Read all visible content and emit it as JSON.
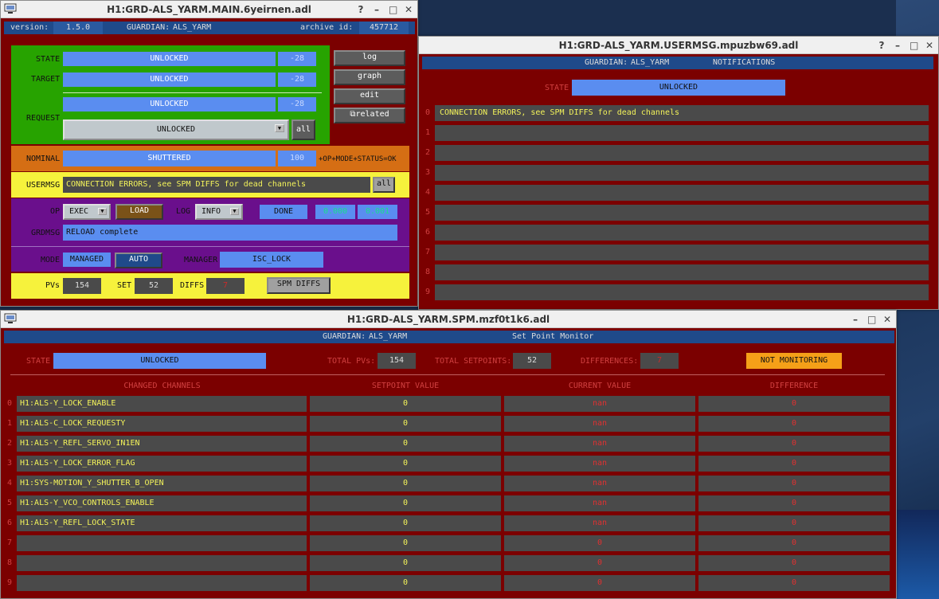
{
  "desktop": {
    "accent": "#1f4a8a"
  },
  "main": {
    "title": "H1:GRD-ALS_YARM.MAIN.6yeirnen.adl",
    "version_label": "version:",
    "version": "1.5.0",
    "guardian_label": "GUARDIAN:",
    "guardian": "ALS_YARM",
    "archive_label": "archive id:",
    "archive_id": "457712",
    "state_label": "STATE",
    "state_value": "UNLOCKED",
    "state_num": "-28",
    "target_label": "TARGET",
    "target_value": "UNLOCKED",
    "target_num": "-28",
    "request_label": "REQUEST",
    "request_value": "UNLOCKED",
    "request_num": "-28",
    "request_select": "UNLOCKED",
    "all_label": "all",
    "log_btn": "log",
    "graph_btn": "graph",
    "edit_btn": "edit",
    "related_btn": "related",
    "nominal_label": "NOMINAL",
    "nominal_value": "SHUTTERED",
    "nominal_num": "100",
    "nominal_status": "+OP+MODE+STATUS=OK",
    "usermsg_label": "USERMSG",
    "usermsg_text": "CONNECTION ERRORS, see SPM DIFFS for dead channels",
    "usermsg_all": "all",
    "op_label": "OP",
    "op_value": "EXEC",
    "load_btn": "LOAD",
    "log_label": "LOG",
    "log_value": "INFO",
    "done_label": "DONE",
    "done_val1": "0.000",
    "done_val2": "0.001",
    "grdmsg_label": "GRDMSG",
    "grdmsg_text": "RELOAD complete",
    "mode_label": "MODE",
    "mode_value": "MANAGED",
    "auto_btn": "AUTO",
    "manager_label": "MANAGER",
    "manager_value": "ISC_LOCK",
    "pvs_label": "PVs",
    "pvs_value": "154",
    "set_label": "SET",
    "set_value": "52",
    "diffs_label": "DIFFS",
    "diffs_value": "7",
    "spm_btn": "SPM DIFFS"
  },
  "usermsg_win": {
    "title": "H1:GRD-ALS_YARM.USERMSG.mpuzbw69.adl",
    "guardian_label": "GUARDIAN:",
    "guardian": "ALS_YARM",
    "notifications": "NOTIFICATIONS",
    "state_label": "STATE",
    "state_value": "UNLOCKED",
    "rows": [
      {
        "idx": "0",
        "text": "CONNECTION ERRORS, see SPM DIFFS for dead channels"
      },
      {
        "idx": "1",
        "text": ""
      },
      {
        "idx": "2",
        "text": ""
      },
      {
        "idx": "3",
        "text": ""
      },
      {
        "idx": "4",
        "text": ""
      },
      {
        "idx": "5",
        "text": ""
      },
      {
        "idx": "6",
        "text": ""
      },
      {
        "idx": "7",
        "text": ""
      },
      {
        "idx": "8",
        "text": ""
      },
      {
        "idx": "9",
        "text": ""
      }
    ]
  },
  "spm": {
    "title": "H1:GRD-ALS_YARM.SPM.mzf0t1k6.adl",
    "guardian_label": "GUARDIAN:",
    "guardian": "ALS_YARM",
    "header_title": "Set Point Monitor",
    "state_label": "STATE",
    "state_value": "UNLOCKED",
    "total_pvs_label": "TOTAL PVs:",
    "total_pvs": "154",
    "total_setpoints_label": "TOTAL SETPOINTS:",
    "total_setpoints": "52",
    "differences_label": "DIFFERENCES:",
    "differences": "7",
    "monitoring": "NOT MONITORING",
    "col_changed": "CHANGED CHANNELS",
    "col_setpoint": "SETPOINT VALUE",
    "col_current": "CURRENT VALUE",
    "col_difference": "DIFFERENCE",
    "rows": [
      {
        "idx": "0",
        "channel": "H1:ALS-Y_LOCK_ENABLE",
        "setpoint": "0",
        "current": "nan",
        "diff": "0"
      },
      {
        "idx": "1",
        "channel": "H1:ALS-C_LOCK_REQUESTY",
        "setpoint": "0",
        "current": "nan",
        "diff": "0"
      },
      {
        "idx": "2",
        "channel": "H1:ALS-Y_REFL_SERVO_IN1EN",
        "setpoint": "0",
        "current": "nan",
        "diff": "0"
      },
      {
        "idx": "3",
        "channel": "H1:ALS-Y_LOCK_ERROR_FLAG",
        "setpoint": "0",
        "current": "nan",
        "diff": "0"
      },
      {
        "idx": "4",
        "channel": "H1:SYS-MOTION_Y_SHUTTER_B_OPEN",
        "setpoint": "0",
        "current": "nan",
        "diff": "0"
      },
      {
        "idx": "5",
        "channel": "H1:ALS-Y_VCO_CONTROLS_ENABLE",
        "setpoint": "0",
        "current": "nan",
        "diff": "0"
      },
      {
        "idx": "6",
        "channel": "H1:ALS-Y_REFL_LOCK_STATE",
        "setpoint": "0",
        "current": "nan",
        "diff": "0"
      },
      {
        "idx": "7",
        "channel": "",
        "setpoint": "0",
        "current": "0",
        "diff": "0"
      },
      {
        "idx": "8",
        "channel": "",
        "setpoint": "0",
        "current": "0",
        "diff": "0"
      },
      {
        "idx": "9",
        "channel": "",
        "setpoint": "0",
        "current": "0",
        "diff": "0"
      }
    ]
  }
}
